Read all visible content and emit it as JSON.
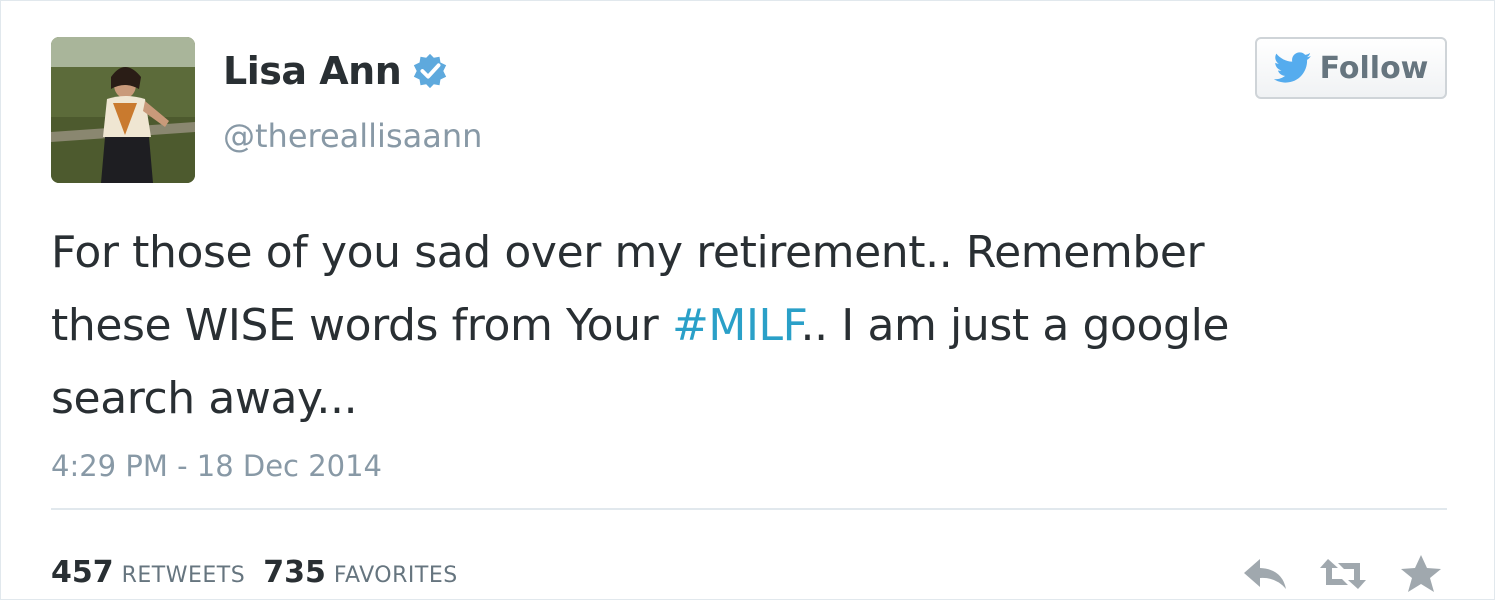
{
  "user": {
    "name": "Lisa Ann",
    "handle": "@thereallisaann",
    "verified": true
  },
  "follow_button": {
    "label": "Follow"
  },
  "tweet": {
    "line1": "For those of you sad over my retirement.. Remember",
    "line2_before": "these WISE words from Your ",
    "hashtag": "#MILF",
    "line2_after": ".. I am just a google",
    "line3": "search away...",
    "timestamp": "4:29 PM - 18 Dec 2014"
  },
  "stats": {
    "retweets_count": "457",
    "retweets_label": "RETWEETS",
    "favorites_count": "735",
    "favorites_label": "FAVORITES"
  },
  "icons": {
    "reply": "reply-icon",
    "retweet": "retweet-icon",
    "favorite": "star-icon",
    "bird": "twitter-bird-icon",
    "verified": "verified-badge-icon"
  },
  "colors": {
    "hashtag": "#2aa0c8",
    "verified": "#5ea9dd",
    "bird": "#55acee",
    "muted": "#8899a6"
  }
}
